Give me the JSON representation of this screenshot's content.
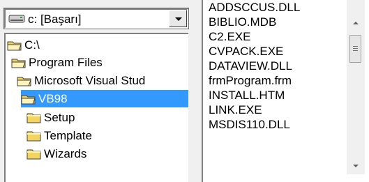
{
  "drive": {
    "label": "c: [Başarı]"
  },
  "directories": [
    {
      "label": "C:\\",
      "icon": "open-folder-icon",
      "selected": false
    },
    {
      "label": "Program Files",
      "icon": "open-folder-icon",
      "selected": false
    },
    {
      "label": "Microsoft Visual Stud",
      "icon": "open-folder-icon",
      "selected": false
    },
    {
      "label": "VB98",
      "icon": "open-folder-icon",
      "selected": true
    },
    {
      "label": "Setup",
      "icon": "closed-folder-icon",
      "selected": false
    },
    {
      "label": "Template",
      "icon": "closed-folder-icon",
      "selected": false
    },
    {
      "label": "Wizards",
      "icon": "closed-folder-icon",
      "selected": false
    }
  ],
  "files": [
    "ADDSCCUS.DLL",
    "BIBLIO.MDB",
    "C2.EXE",
    "CVPACK.EXE",
    "DATAVIEW.DLL",
    "frmProgram.frm",
    "INSTALL.HTM",
    "LINK.EXE",
    "MSDIS110.DLL"
  ],
  "colors": {
    "selection": "#3399ff",
    "folder": "#f4d35e"
  }
}
